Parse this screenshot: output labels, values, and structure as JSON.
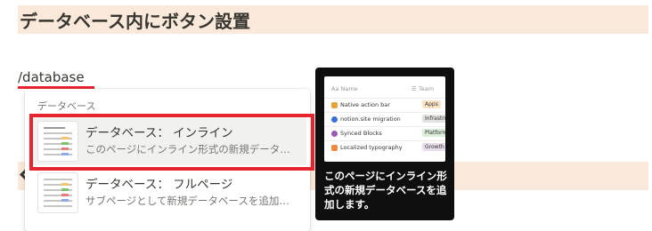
{
  "heading": {
    "text": "データベース内にボタン設置"
  },
  "command": {
    "text": "/database"
  },
  "menu": {
    "section_label": "データベース",
    "items": [
      {
        "title": "データベース： インライン",
        "description": "このページにインライン形式の新規データ…",
        "icon": "table-thumbnail-icon"
      },
      {
        "title": "データベース： フルページ",
        "description": "サブページとして新規データベースを追加…",
        "icon": "table-thumbnail-icon"
      }
    ]
  },
  "tooltip": {
    "preview": {
      "columns": [
        "Name",
        "Team"
      ],
      "rows": [
        {
          "name": "Native action bar",
          "team": "Apps",
          "icon": "pencil-icon"
        },
        {
          "name": "notion.site migration",
          "team": "Infrastruct",
          "icon": "globe-icon"
        },
        {
          "name": "Synced Blocks",
          "team": "Platform",
          "icon": "sync-icon"
        },
        {
          "name": "Localized typography",
          "team": "Growth",
          "icon": "typography-icon"
        }
      ]
    },
    "text": "このページにインライン形式の新規データベースを追加します。"
  },
  "colors": {
    "highlight": "#e8242f",
    "heading_band": "#fbeadb",
    "tooltip_bg": "#0f0f0f"
  }
}
